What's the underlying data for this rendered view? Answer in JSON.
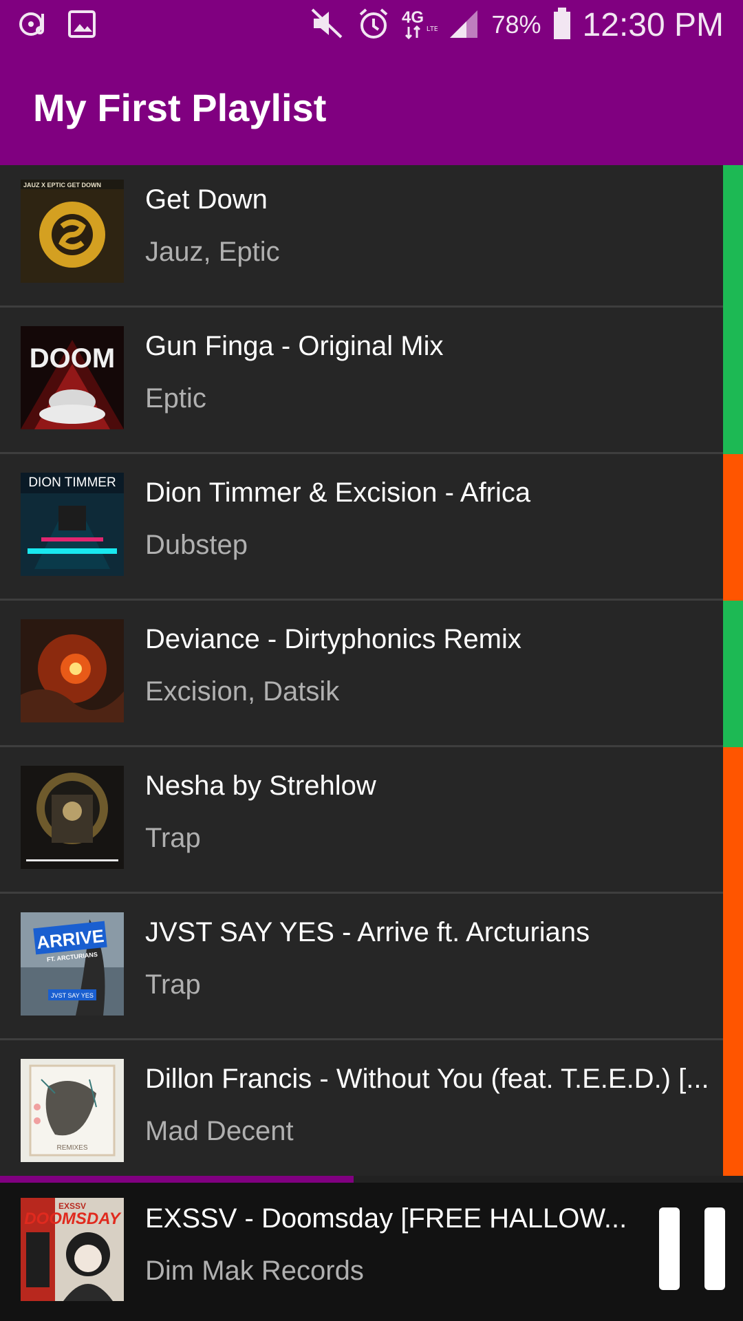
{
  "status_bar": {
    "icons_left": [
      "music-player-icon",
      "image-icon"
    ],
    "icons_right": [
      "mute-icon",
      "alarm-icon",
      "network-4g-lte-icon",
      "signal-icon",
      "battery-icon"
    ],
    "battery": "78%",
    "time": "12:30 PM"
  },
  "header": {
    "title": "My First Playlist"
  },
  "tracks": [
    {
      "title": "Get Down",
      "subtitle": "Jauz, Eptic",
      "indicator_color": "#1DB954"
    },
    {
      "title": "Gun Finga - Original Mix",
      "subtitle": "Eptic",
      "indicator_color": "#1DB954"
    },
    {
      "title": "Dion Timmer & Excision - Africa",
      "subtitle": "Dubstep",
      "indicator_color": "#FF5500"
    },
    {
      "title": "Deviance - Dirtyphonics Remix",
      "subtitle": "Excision, Datsik",
      "indicator_color": "#1DB954"
    },
    {
      "title": "Nesha by Strehlow",
      "subtitle": "Trap",
      "indicator_color": "#FF5500"
    },
    {
      "title": "JVST SAY YES - Arrive ft. Arcturians",
      "subtitle": "Trap",
      "indicator_color": "#FF5500"
    },
    {
      "title": "Dillon Francis - Without You (feat. T.E.E.D.) [...",
      "subtitle": "Mad Decent",
      "indicator_color": "#FF5500"
    }
  ],
  "album_art_text": {
    "get_down": "JAUZ X EPTIC GET DOWN",
    "gun_finga": "DOOM",
    "africa": "DION TIMMER",
    "arrive": "ARRIVE",
    "arrive_ft": "FT. ARCTURIANS",
    "arrive_artist": "JVST SAY YES",
    "without_you": "REMIXES",
    "doomsday": "DOOMSDAY",
    "doomsday_artist": "EXSSV"
  },
  "now_playing": {
    "title": "EXSSV - Doomsday [FREE HALLOW...",
    "subtitle": "Dim Mak Records",
    "progress": 0.476,
    "control_icon": "pause-icon"
  },
  "colors": {
    "accent": "#800080",
    "spotify_green": "#1DB954",
    "soundcloud_orange": "#FF5500"
  }
}
